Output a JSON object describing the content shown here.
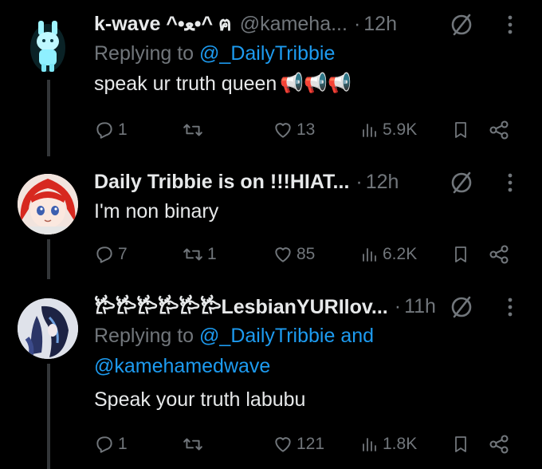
{
  "posts": [
    {
      "name": "k-wave ^•ﻌ•^ ฅ",
      "handle": "@kameha...",
      "time": "12h",
      "replying_prefix": "Replying to",
      "replying_to": "@_DailyTribbie",
      "replying_to_2": "",
      "text": "speak ur truth queen",
      "emoji": "📢📢📢",
      "stats": {
        "replies": "1",
        "reposts": "",
        "likes": "13",
        "views": "5.9K"
      }
    },
    {
      "name": "Daily Tribbie is on !!!HIAT...",
      "handle": "",
      "time": "12h",
      "text": "I'm non binary",
      "stats": {
        "replies": "7",
        "reposts": "1",
        "likes": "85",
        "views": "6.2K"
      }
    },
    {
      "name": "𐂂𐂂𐂂𐂂𐂂𐂂LesbianYURIlov...",
      "handle": "",
      "time": "11h",
      "replying_prefix": "Replying to",
      "replying_to": "@_DailyTribbie and",
      "replying_to_2": "@kamehamedwave",
      "text": "Speak your truth labubu",
      "stats": {
        "replies": "1",
        "reposts": "",
        "likes": "121",
        "views": "1.8K"
      }
    }
  ],
  "dot": "·",
  "colors": {
    "background": "#000000",
    "text": "#e7e9ea",
    "muted": "#71767b",
    "link": "#1d9bf0",
    "thread": "#333639"
  },
  "icons": [
    "reply-icon",
    "repost-icon",
    "like-icon",
    "views-icon",
    "bookmark-icon",
    "share-icon",
    "grok-icon",
    "more-icon"
  ]
}
